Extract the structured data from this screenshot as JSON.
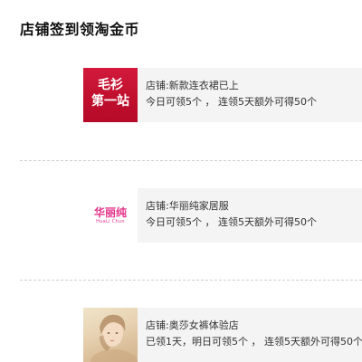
{
  "page": {
    "title": "店铺签到领淘金币"
  },
  "shops": [
    {
      "thumb_text": [
        "毛衫",
        "第一站"
      ],
      "name": "店铺:新款连衣裙已上",
      "reward": "今日可领5个 ， 连领5天额外可得50个"
    },
    {
      "thumb_text": [
        "华丽纯",
        "HuaLi Chun"
      ],
      "name": "店铺:华丽纯家居服",
      "reward": "今日可领5个 ， 连领5天额外可得50个"
    },
    {
      "thumb_text": [],
      "name": "店铺:奥莎女裤体验店",
      "reward": "已领1天，明日可领5个 ， 连领5天额外可得50个"
    }
  ],
  "colors": {
    "badge_red": "#c8143a",
    "logo_pink": "#e5338a",
    "info_bg": "#f4f4f4",
    "divider": "#cfcfcf"
  }
}
